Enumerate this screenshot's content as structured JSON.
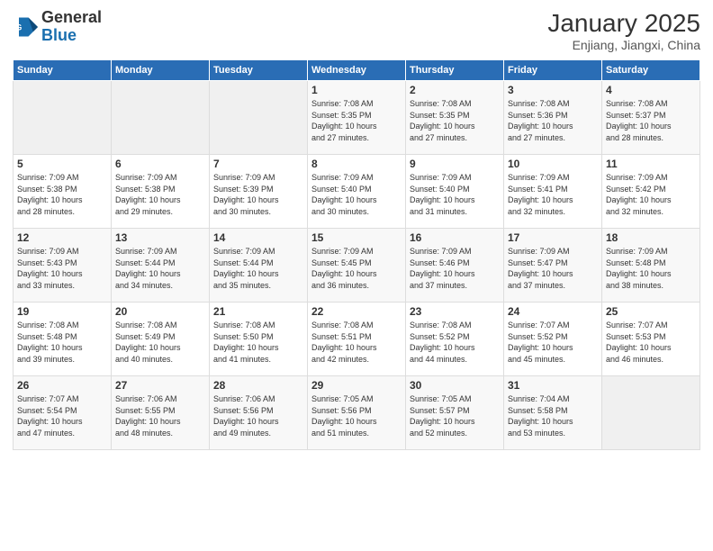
{
  "header": {
    "logo": {
      "line1": "General",
      "line2": "Blue"
    },
    "title": "January 2025",
    "subtitle": "Enjiang, Jiangxi, China"
  },
  "weekdays": [
    "Sunday",
    "Monday",
    "Tuesday",
    "Wednesday",
    "Thursday",
    "Friday",
    "Saturday"
  ],
  "weeks": [
    [
      {
        "day": "",
        "info": ""
      },
      {
        "day": "",
        "info": ""
      },
      {
        "day": "",
        "info": ""
      },
      {
        "day": "1",
        "info": "Sunrise: 7:08 AM\nSunset: 5:35 PM\nDaylight: 10 hours\nand 27 minutes."
      },
      {
        "day": "2",
        "info": "Sunrise: 7:08 AM\nSunset: 5:35 PM\nDaylight: 10 hours\nand 27 minutes."
      },
      {
        "day": "3",
        "info": "Sunrise: 7:08 AM\nSunset: 5:36 PM\nDaylight: 10 hours\nand 27 minutes."
      },
      {
        "day": "4",
        "info": "Sunrise: 7:08 AM\nSunset: 5:37 PM\nDaylight: 10 hours\nand 28 minutes."
      }
    ],
    [
      {
        "day": "5",
        "info": "Sunrise: 7:09 AM\nSunset: 5:38 PM\nDaylight: 10 hours\nand 28 minutes."
      },
      {
        "day": "6",
        "info": "Sunrise: 7:09 AM\nSunset: 5:38 PM\nDaylight: 10 hours\nand 29 minutes."
      },
      {
        "day": "7",
        "info": "Sunrise: 7:09 AM\nSunset: 5:39 PM\nDaylight: 10 hours\nand 30 minutes."
      },
      {
        "day": "8",
        "info": "Sunrise: 7:09 AM\nSunset: 5:40 PM\nDaylight: 10 hours\nand 30 minutes."
      },
      {
        "day": "9",
        "info": "Sunrise: 7:09 AM\nSunset: 5:40 PM\nDaylight: 10 hours\nand 31 minutes."
      },
      {
        "day": "10",
        "info": "Sunrise: 7:09 AM\nSunset: 5:41 PM\nDaylight: 10 hours\nand 32 minutes."
      },
      {
        "day": "11",
        "info": "Sunrise: 7:09 AM\nSunset: 5:42 PM\nDaylight: 10 hours\nand 32 minutes."
      }
    ],
    [
      {
        "day": "12",
        "info": "Sunrise: 7:09 AM\nSunset: 5:43 PM\nDaylight: 10 hours\nand 33 minutes."
      },
      {
        "day": "13",
        "info": "Sunrise: 7:09 AM\nSunset: 5:44 PM\nDaylight: 10 hours\nand 34 minutes."
      },
      {
        "day": "14",
        "info": "Sunrise: 7:09 AM\nSunset: 5:44 PM\nDaylight: 10 hours\nand 35 minutes."
      },
      {
        "day": "15",
        "info": "Sunrise: 7:09 AM\nSunset: 5:45 PM\nDaylight: 10 hours\nand 36 minutes."
      },
      {
        "day": "16",
        "info": "Sunrise: 7:09 AM\nSunset: 5:46 PM\nDaylight: 10 hours\nand 37 minutes."
      },
      {
        "day": "17",
        "info": "Sunrise: 7:09 AM\nSunset: 5:47 PM\nDaylight: 10 hours\nand 37 minutes."
      },
      {
        "day": "18",
        "info": "Sunrise: 7:09 AM\nSunset: 5:48 PM\nDaylight: 10 hours\nand 38 minutes."
      }
    ],
    [
      {
        "day": "19",
        "info": "Sunrise: 7:08 AM\nSunset: 5:48 PM\nDaylight: 10 hours\nand 39 minutes."
      },
      {
        "day": "20",
        "info": "Sunrise: 7:08 AM\nSunset: 5:49 PM\nDaylight: 10 hours\nand 40 minutes."
      },
      {
        "day": "21",
        "info": "Sunrise: 7:08 AM\nSunset: 5:50 PM\nDaylight: 10 hours\nand 41 minutes."
      },
      {
        "day": "22",
        "info": "Sunrise: 7:08 AM\nSunset: 5:51 PM\nDaylight: 10 hours\nand 42 minutes."
      },
      {
        "day": "23",
        "info": "Sunrise: 7:08 AM\nSunset: 5:52 PM\nDaylight: 10 hours\nand 44 minutes."
      },
      {
        "day": "24",
        "info": "Sunrise: 7:07 AM\nSunset: 5:52 PM\nDaylight: 10 hours\nand 45 minutes."
      },
      {
        "day": "25",
        "info": "Sunrise: 7:07 AM\nSunset: 5:53 PM\nDaylight: 10 hours\nand 46 minutes."
      }
    ],
    [
      {
        "day": "26",
        "info": "Sunrise: 7:07 AM\nSunset: 5:54 PM\nDaylight: 10 hours\nand 47 minutes."
      },
      {
        "day": "27",
        "info": "Sunrise: 7:06 AM\nSunset: 5:55 PM\nDaylight: 10 hours\nand 48 minutes."
      },
      {
        "day": "28",
        "info": "Sunrise: 7:06 AM\nSunset: 5:56 PM\nDaylight: 10 hours\nand 49 minutes."
      },
      {
        "day": "29",
        "info": "Sunrise: 7:05 AM\nSunset: 5:56 PM\nDaylight: 10 hours\nand 51 minutes."
      },
      {
        "day": "30",
        "info": "Sunrise: 7:05 AM\nSunset: 5:57 PM\nDaylight: 10 hours\nand 52 minutes."
      },
      {
        "day": "31",
        "info": "Sunrise: 7:04 AM\nSunset: 5:58 PM\nDaylight: 10 hours\nand 53 minutes."
      },
      {
        "day": "",
        "info": ""
      }
    ]
  ]
}
